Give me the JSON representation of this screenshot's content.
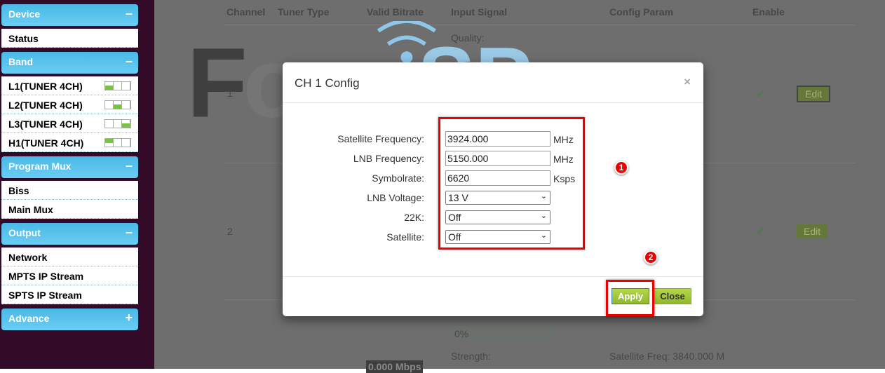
{
  "sidebar": {
    "device": {
      "title": "Device",
      "toggle": "–",
      "items": [
        "Status"
      ]
    },
    "band": {
      "title": "Band",
      "toggle": "–",
      "items": [
        "L1(TUNER 4CH)",
        "L2(TUNER 4CH)",
        "L3(TUNER 4CH)",
        "H1(TUNER 4CH)"
      ]
    },
    "program_mux": {
      "title": "Program Mux",
      "toggle": "–",
      "items": [
        "Biss",
        "Main Mux"
      ]
    },
    "output": {
      "title": "Output",
      "toggle": "–",
      "items": [
        "Network",
        "MPTS IP Stream",
        "SPTS IP Stream"
      ]
    },
    "advance": {
      "title": "Advance",
      "toggle": "+"
    }
  },
  "table": {
    "headers": [
      "Channel",
      "Tuner Type",
      "Valid Bitrate",
      "Input Signal",
      "Config Param",
      "Enable"
    ],
    "rows": [
      {
        "channel": "1",
        "edit": "Edit"
      },
      {
        "channel": "2",
        "edit": "Edit"
      }
    ],
    "quality_label": "Quality:",
    "percent": "0%",
    "strength_label": "Strength:",
    "sat_freq": "Satellite Freq: 3840.000 M",
    "bitrate": "0.000 Mbps"
  },
  "watermark": {
    "text": "ForoISP"
  },
  "modal": {
    "title": "CH 1 Config",
    "close_icon": "×",
    "fields": [
      {
        "label": "Satellite Frequency:",
        "value": "3924.000",
        "unit": "MHz"
      },
      {
        "label": "LNB Frequency:",
        "value": "5150.000",
        "unit": "MHz"
      },
      {
        "label": "Symbolrate:",
        "value": "6620",
        "unit": "Ksps"
      },
      {
        "label": "LNB Voltage:",
        "value": "13 V"
      },
      {
        "label": "22K:",
        "value": "Off"
      },
      {
        "label": "Satellite:",
        "value": "Off"
      }
    ],
    "apply": "Apply",
    "close": "Close",
    "markers": [
      "1",
      "2"
    ]
  },
  "colors": {
    "sidebar_bg": "#330a28",
    "header_blue": "#4ab9e6",
    "button_green": "#9ec63a",
    "highlight_red": "#e00000"
  }
}
